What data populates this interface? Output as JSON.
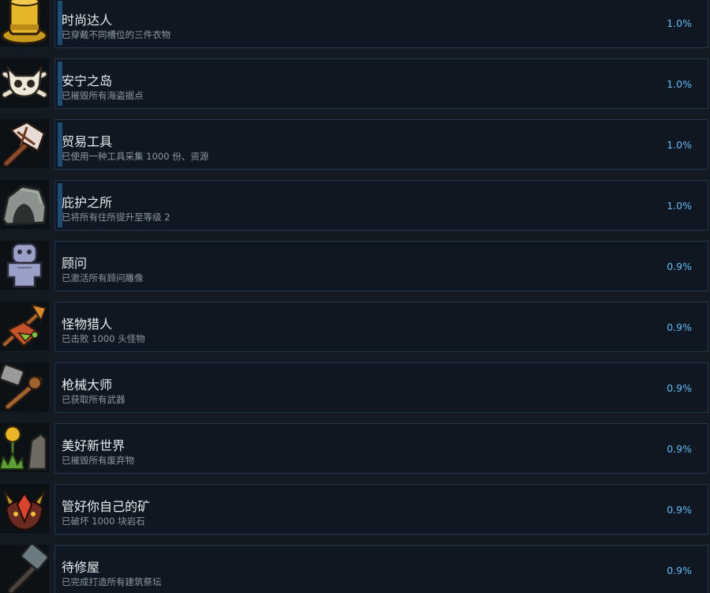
{
  "achievements": [
    {
      "title": "时尚达人",
      "desc": "已穿戴不同槽位的三件衣物",
      "percent": "1.0%",
      "icon": "top-hat-icon",
      "highlight": true
    },
    {
      "title": "安宁之岛",
      "desc": "已摧毁所有海盗据点",
      "percent": "1.0%",
      "icon": "skull-crossbones-icon",
      "highlight": true
    },
    {
      "title": "贸易工具",
      "desc": "已使用一种工具采集 1000 份、资源",
      "percent": "1.0%",
      "icon": "axe-icon",
      "highlight": true
    },
    {
      "title": "庇护之所",
      "desc": "已将所有住所提升至等级 2",
      "percent": "1.0%",
      "icon": "shelter-rock-icon",
      "highlight": true
    },
    {
      "title": "顾问",
      "desc": "已激活所有顾问雕像",
      "percent": "0.9%",
      "icon": "statue-icon",
      "highlight": false
    },
    {
      "title": "怪物猎人",
      "desc": "已击败 1000 头怪物",
      "percent": "0.9%",
      "icon": "monster-hunter-icon",
      "highlight": false
    },
    {
      "title": "枪械大师",
      "desc": "已获取所有武器",
      "percent": "0.9%",
      "icon": "hammer-weapon-icon",
      "highlight": false
    },
    {
      "title": "美好新世界",
      "desc": "已摧毁所有废弃物",
      "percent": "0.9%",
      "icon": "new-world-icon",
      "highlight": false
    },
    {
      "title": "管好你自己的矿",
      "desc": "已破坏 1000 块岩石",
      "percent": "0.9%",
      "icon": "horned-demon-icon",
      "highlight": false
    },
    {
      "title": "待修屋",
      "desc": "已完成打造所有建筑祭坛",
      "percent": "0.9%",
      "icon": "repair-hammer-icon",
      "highlight": false
    }
  ]
}
